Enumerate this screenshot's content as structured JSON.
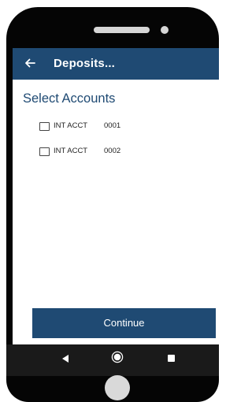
{
  "appbar": {
    "back_icon": "arrow-left-icon",
    "title": "Deposits..."
  },
  "section": {
    "title": "Select Accounts"
  },
  "accounts": [
    {
      "label": "INT ACCT",
      "number": "0001",
      "checked": false
    },
    {
      "label": "INT ACCT",
      "number": "0002",
      "checked": false
    }
  ],
  "actions": {
    "continue_label": "Continue"
  },
  "system_nav": {
    "back_icon": "triangle-back-icon",
    "home_icon": "circle-home-icon",
    "recents_icon": "square-recents-icon"
  },
  "colors": {
    "primary": "#1f4a73",
    "frame": "#050505",
    "navbar": "#1a1a1a"
  }
}
